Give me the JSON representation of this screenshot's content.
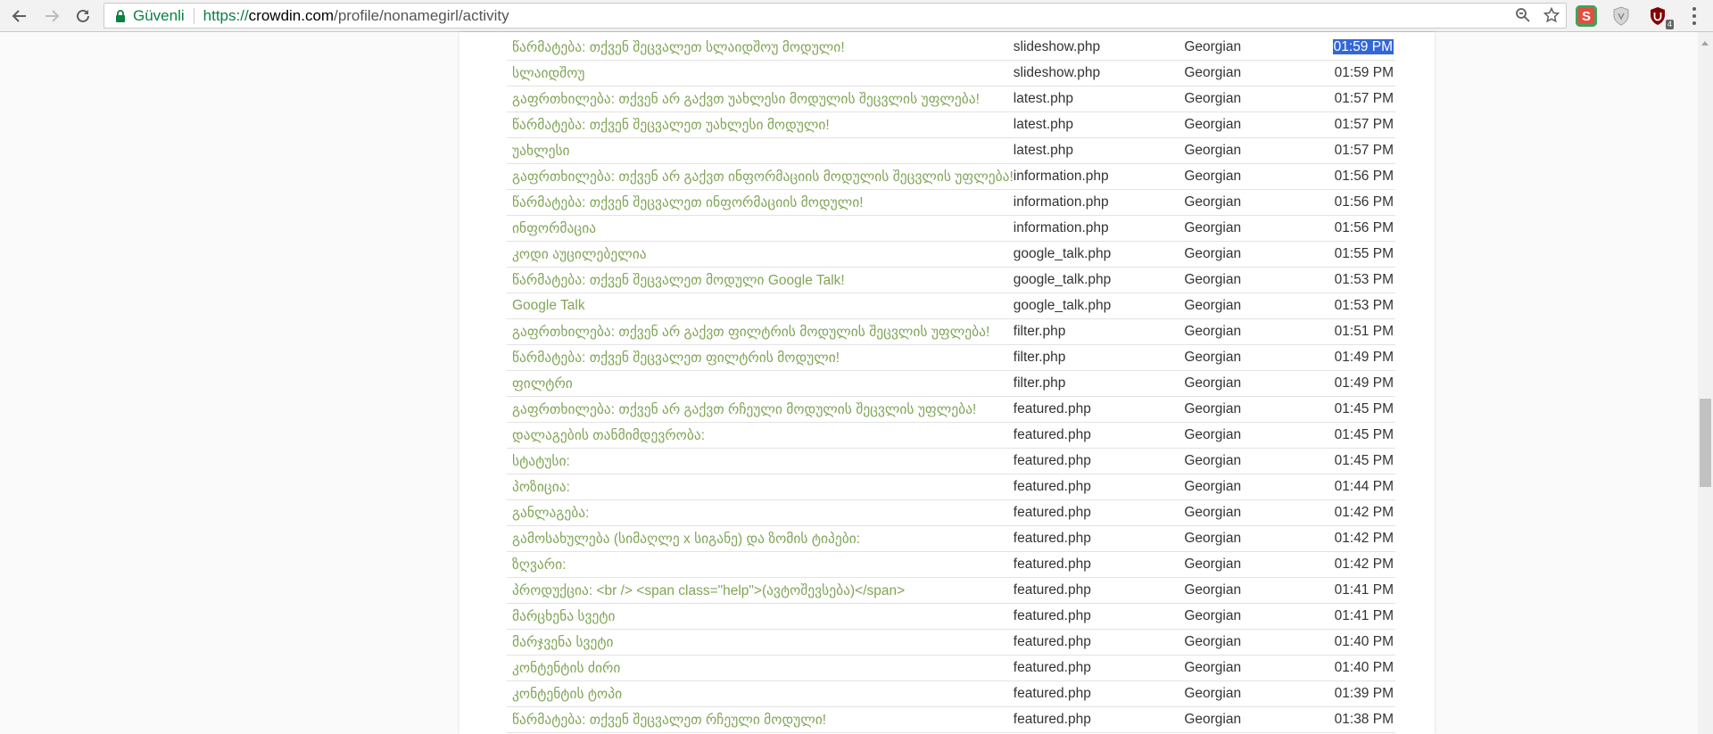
{
  "browser": {
    "secure_label": "Güvenli",
    "url_scheme": "https://",
    "url_host": "crowdin.com",
    "url_path": "/profile/nonamegirl/activity",
    "extension_s_label": "S",
    "extension_badge": "4",
    "colors": {
      "secure": "#0b8043",
      "link": "#80a556",
      "selection": "#3367d6"
    }
  },
  "activity": {
    "rows": [
      {
        "text": "წარმატება: თქვენ შეცვალეთ სლაიდშოუ მოდული!",
        "file": "slideshow.php",
        "language": "Georgian",
        "time": "01:59 PM",
        "selected": true
      },
      {
        "text": "სლაიდშოუ",
        "file": "slideshow.php",
        "language": "Georgian",
        "time": "01:59 PM"
      },
      {
        "text": "გაფრთხილება: თქვენ არ გაქვთ უახლესი მოდულის შეცვლის უფლება!",
        "file": "latest.php",
        "language": "Georgian",
        "time": "01:57 PM"
      },
      {
        "text": "წარმატება: თქვენ შეცვალეთ უახლესი მოდული!",
        "file": "latest.php",
        "language": "Georgian",
        "time": "01:57 PM"
      },
      {
        "text": "უახლესი",
        "file": "latest.php",
        "language": "Georgian",
        "time": "01:57 PM"
      },
      {
        "text": "გაფრთხილება: თქვენ არ გაქვთ ინფორმაციის მოდულის შეცვლის უფლება!",
        "file": "information.php",
        "language": "Georgian",
        "time": "01:56 PM"
      },
      {
        "text": "წარმატება: თქვენ შეცვალეთ ინფორმაციის მოდული!",
        "file": "information.php",
        "language": "Georgian",
        "time": "01:56 PM"
      },
      {
        "text": "ინფორმაცია",
        "file": "information.php",
        "language": "Georgian",
        "time": "01:56 PM"
      },
      {
        "text": "კოდი აუცილებელია",
        "file": "google_talk.php",
        "language": "Georgian",
        "time": "01:55 PM"
      },
      {
        "text": "წარმატება: თქვენ შეცვალეთ მოდული Google Talk!",
        "file": "google_talk.php",
        "language": "Georgian",
        "time": "01:53 PM"
      },
      {
        "text": "Google Talk",
        "file": "google_talk.php",
        "language": "Georgian",
        "time": "01:53 PM"
      },
      {
        "text": "გაფრთხილება: თქვენ არ გაქვთ ფილტრის მოდულის შეცვლის უფლება!",
        "file": "filter.php",
        "language": "Georgian",
        "time": "01:51 PM"
      },
      {
        "text": "წარმატება: თქვენ შეცვალეთ ფილტრის მოდული!",
        "file": "filter.php",
        "language": "Georgian",
        "time": "01:49 PM"
      },
      {
        "text": "ფილტრი",
        "file": "filter.php",
        "language": "Georgian",
        "time": "01:49 PM"
      },
      {
        "text": "გაფრთხილება: თქვენ არ გაქვთ რჩეული მოდულის შეცვლის უფლება!",
        "file": "featured.php",
        "language": "Georgian",
        "time": "01:45 PM"
      },
      {
        "text": "დალაგების თანმიმდევრობა:",
        "file": "featured.php",
        "language": "Georgian",
        "time": "01:45 PM"
      },
      {
        "text": "სტატუსი:",
        "file": "featured.php",
        "language": "Georgian",
        "time": "01:45 PM"
      },
      {
        "text": "პოზიცია:",
        "file": "featured.php",
        "language": "Georgian",
        "time": "01:44 PM"
      },
      {
        "text": "განლაგება:",
        "file": "featured.php",
        "language": "Georgian",
        "time": "01:42 PM"
      },
      {
        "text": "გამოსახულება (სიმაღლე x სიგანე) და ზომის ტიპები:",
        "file": "featured.php",
        "language": "Georgian",
        "time": "01:42 PM"
      },
      {
        "text": "ზღვარი:",
        "file": "featured.php",
        "language": "Georgian",
        "time": "01:42 PM"
      },
      {
        "text": "პროდუქცია: <br /> <span class=\"help\">(ავტოშევსება)</span>",
        "file": "featured.php",
        "language": "Georgian",
        "time": "01:41 PM"
      },
      {
        "text": "მარცხენა სვეტი",
        "file": "featured.php",
        "language": "Georgian",
        "time": "01:41 PM"
      },
      {
        "text": "მარჯვენა სვეტი",
        "file": "featured.php",
        "language": "Georgian",
        "time": "01:40 PM"
      },
      {
        "text": "კონტენტის ძირი",
        "file": "featured.php",
        "language": "Georgian",
        "time": "01:40 PM"
      },
      {
        "text": "კონტენტის ტოპი",
        "file": "featured.php",
        "language": "Georgian",
        "time": "01:39 PM"
      },
      {
        "text": "წარმატება: თქვენ შეცვალეთ რჩეული მოდული!",
        "file": "featured.php",
        "language": "Georgian",
        "time": "01:38 PM"
      }
    ]
  }
}
